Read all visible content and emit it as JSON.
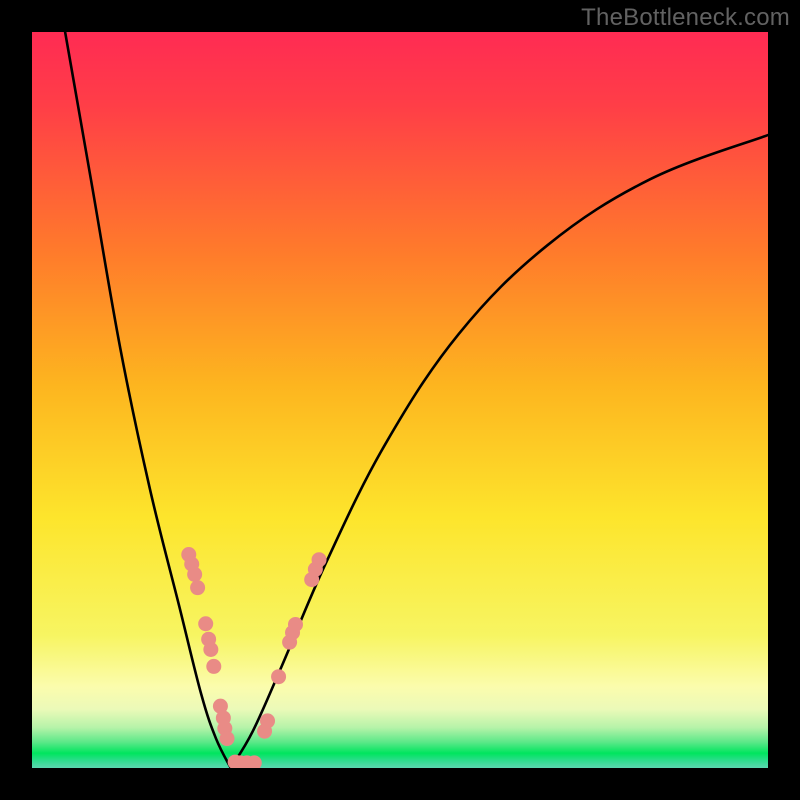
{
  "watermark": "TheBottleneck.com",
  "colors": {
    "frame": "#000000",
    "curve": "#000000",
    "dots": "#E98B86",
    "grad_top": "#FF2B53",
    "grad_mid1": "#FF9A1E",
    "grad_mid2": "#FDE52C",
    "grad_pale": "#FBFCAD",
    "grad_green": "#00E55E",
    "grad_bottom_edge": "#5BD7B0"
  },
  "chart_data": {
    "type": "line",
    "title": "",
    "xlabel": "",
    "ylabel": "",
    "xlim": [
      0,
      100
    ],
    "ylim": [
      0,
      100
    ],
    "notes": "V-shaped bottleneck curve. X-axis represents relative component capability (unlabeled). Y-axis represents bottleneck percentage (unlabeled). Valley at ~27% x where bottleneck reaches ~0%. Dots cluster near the valley on both branches (~30% y down to 0%).",
    "series": [
      {
        "name": "bottleneck-curve-left",
        "x": [
          4.5,
          8,
          12,
          16,
          20,
          23,
          25,
          27
        ],
        "y": [
          100,
          80,
          57,
          38,
          22,
          10,
          4,
          0
        ]
      },
      {
        "name": "bottleneck-curve-right",
        "x": [
          27,
          30,
          34,
          40,
          48,
          58,
          70,
          84,
          100
        ],
        "y": [
          0,
          5,
          14,
          28,
          44,
          59,
          71,
          80,
          86
        ]
      }
    ],
    "dots": [
      {
        "x": 21.3,
        "y": 29.0
      },
      {
        "x": 21.7,
        "y": 27.7
      },
      {
        "x": 22.1,
        "y": 26.3
      },
      {
        "x": 22.5,
        "y": 24.5
      },
      {
        "x": 23.6,
        "y": 19.6
      },
      {
        "x": 24.0,
        "y": 17.5
      },
      {
        "x": 24.3,
        "y": 16.1
      },
      {
        "x": 24.7,
        "y": 13.8
      },
      {
        "x": 25.6,
        "y": 8.4
      },
      {
        "x": 26.0,
        "y": 6.8
      },
      {
        "x": 26.2,
        "y": 5.4
      },
      {
        "x": 26.5,
        "y": 4.0
      },
      {
        "x": 27.6,
        "y": 0.8
      },
      {
        "x": 28.3,
        "y": 0.7
      },
      {
        "x": 29.2,
        "y": 0.7
      },
      {
        "x": 30.2,
        "y": 0.7
      },
      {
        "x": 31.6,
        "y": 5.0
      },
      {
        "x": 32.0,
        "y": 6.4
      },
      {
        "x": 33.5,
        "y": 12.4
      },
      {
        "x": 35.0,
        "y": 17.1
      },
      {
        "x": 35.4,
        "y": 18.4
      },
      {
        "x": 35.8,
        "y": 19.5
      },
      {
        "x": 38.0,
        "y": 25.6
      },
      {
        "x": 38.5,
        "y": 27.0
      },
      {
        "x": 39.0,
        "y": 28.3
      }
    ]
  }
}
